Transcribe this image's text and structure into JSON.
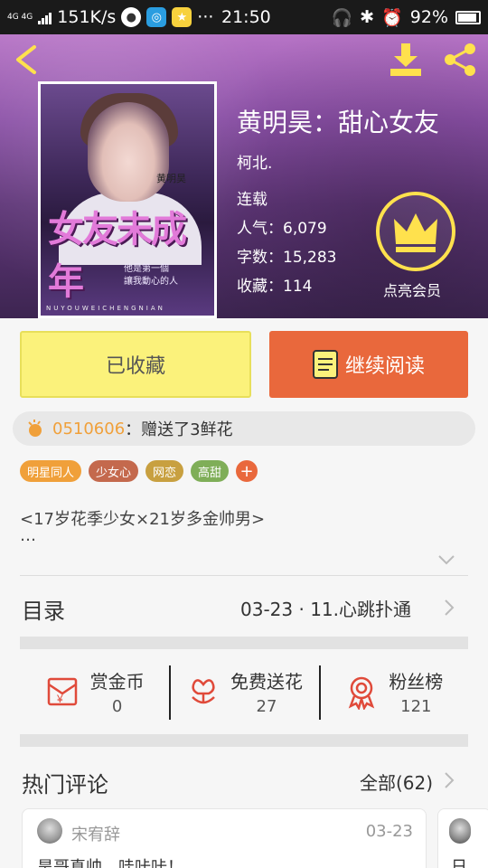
{
  "status_bar": {
    "network": "4G 4G",
    "speed": "151K/s",
    "time": "21:50",
    "battery": "92%"
  },
  "book": {
    "title": "黄明昊：甜心女友",
    "author": "柯北.",
    "status": "连载",
    "popularity": "人气：6,079",
    "word_count": "字数：15,283",
    "favorites": "收藏：114"
  },
  "cover": {
    "name": "黄明昊",
    "title_art": "女友未成年",
    "subtitle_line1": "他是第一個",
    "subtitle_line2": "讓我動心的人",
    "pinyin": "NUYOUWEICHENGNIAN"
  },
  "vip": {
    "label": "点亮会员"
  },
  "actions": {
    "favorited_label": "已收藏",
    "continue_label": "继续阅读"
  },
  "gift": {
    "user": "0510606",
    "text": "：赠送了3鲜花"
  },
  "tags": [
    {
      "label": "明星同人",
      "color": "#f0a03a"
    },
    {
      "label": "少女心",
      "color": "#c4694d"
    },
    {
      "label": "网恋",
      "color": "#c8a040"
    },
    {
      "label": "高甜",
      "color": "#7fae58"
    }
  ],
  "tag_add": "+",
  "description": {
    "line1": "<17岁花季少女×21岁多金帅男>",
    "line2": "…"
  },
  "toc": {
    "label": "目录",
    "latest": "03-23  ·  11.心跳扑通"
  },
  "stats": [
    {
      "name": "赏金币",
      "value": "0",
      "icon": "red-envelope-icon"
    },
    {
      "name": "免费送花",
      "value": "27",
      "icon": "flower-icon"
    },
    {
      "name": "粉丝榜",
      "value": "121",
      "icon": "medal-icon"
    }
  ],
  "comments_section": {
    "label": "热门评论",
    "all_label": "全部(62)"
  },
  "comments": [
    {
      "user": "宋宥辞",
      "date": "03-23",
      "text": "昊哥真帅，哇咔咔！"
    },
    {
      "text": "日"
    }
  ],
  "colors": {
    "accent_orange": "#e9683c",
    "fav_yellow": "#fbf27b",
    "vip_gold": "#ffe14d"
  }
}
